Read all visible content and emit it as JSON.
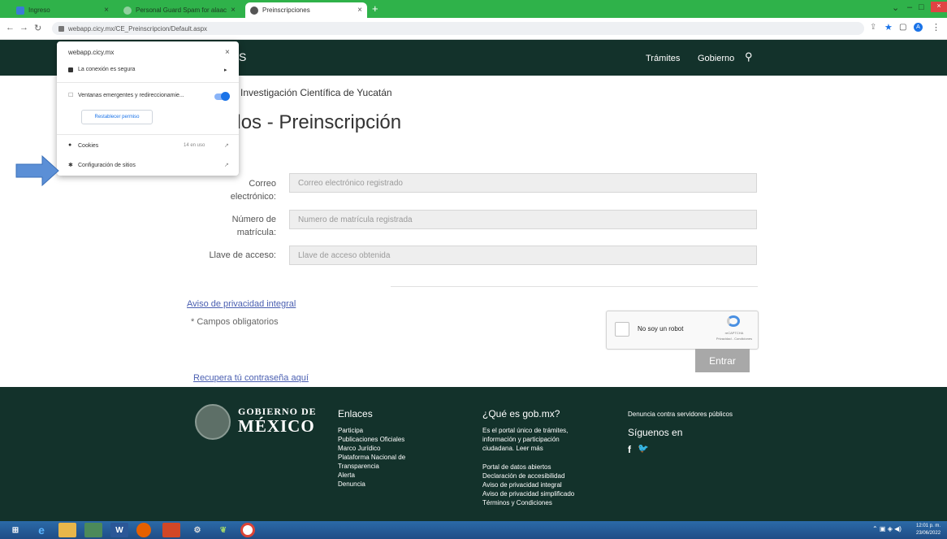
{
  "browser": {
    "tabs": [
      {
        "label": "Ingreso",
        "icon": "green-app-icon"
      },
      {
        "label": "Personal Guard Spam for alaacc",
        "icon": "globe-icon"
      },
      {
        "label": "Preinscripciones",
        "icon": "globe-icon"
      }
    ],
    "url": "webapp.cicy.mx/CE_Preinscripcion/Default.aspx"
  },
  "site_popup": {
    "domain": "webapp.cicy.mx",
    "connection": "La conexión es segura",
    "popups_setting": "Ventanas emergentes y redireccionamie...",
    "popups_enabled": true,
    "reset_button": "Restablecer permiso",
    "cookies_label": "Cookies",
    "cookies_status": "14 en uso",
    "site_settings": "Configuración de sitios"
  },
  "header": {
    "nav": [
      "Trámites",
      "Gobierno"
    ]
  },
  "page": {
    "breadcrumb": "Investigación Científica de Yucatán",
    "title": "rados - Preinscripción",
    "form": {
      "email_label": "Correo electrónico:",
      "email_placeholder": "Correo electrónico registrado",
      "matricula_label": "Número de matrícula:",
      "matricula_placeholder": "Numero de matrícula registrada",
      "key_label": "Llave de acceso:",
      "key_placeholder": "Llave de acceso obtenida"
    },
    "privacy_link": "Aviso de privacidad integral",
    "required_note": "* Campos obligatorios",
    "captcha_label": "No soy un robot",
    "captcha_brand": "reCAPTCHA",
    "captcha_terms": "Privacidad - Condiciones",
    "submit": "Entrar",
    "recover_link": "Recupera tú contraseña aquí"
  },
  "footer": {
    "logo_top": "GOBIERNO DE",
    "logo_main": "MÉXICO",
    "links_title": "Enlaces",
    "links": [
      "Participa",
      "Publicaciones Oficiales",
      "Marco Jurídico",
      "Plataforma Nacional de",
      "Transparencia",
      "Alerta",
      "Denuncia"
    ],
    "gob_title": "¿Qué es gob.mx?",
    "gob_text": [
      "Es el portal único de trámites,",
      "información y participación",
      "ciudadana. Leer más"
    ],
    "gob_links": [
      "Portal de datos abiertos",
      "Declaración de accesibilidad",
      "Aviso de privacidad integral",
      "Aviso de privacidad simplificado",
      "Términos y Condiciones"
    ],
    "denuncia": "Denuncia contra servidores públicos",
    "follow": "Síguenos en"
  },
  "taskbar": {
    "clock_time": "12:01 p. m.",
    "clock_date": "23/06/2022"
  }
}
